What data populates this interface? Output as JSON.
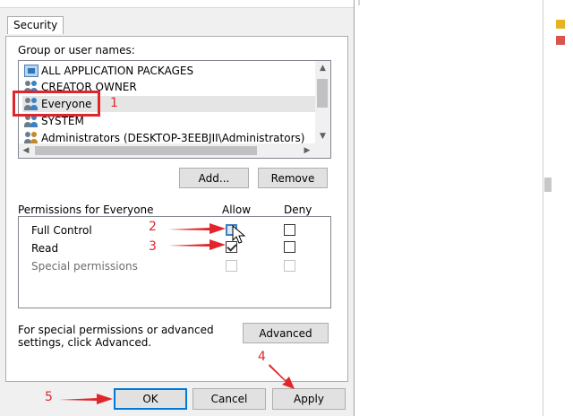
{
  "dialog": {
    "tab_label": "Security",
    "group_label": "Group or user names:",
    "principals": [
      {
        "name": "ALL APPLICATION PACKAGES",
        "icon": "app-packages-icon"
      },
      {
        "name": "CREATOR OWNER",
        "icon": "users-icon"
      },
      {
        "name": "Everyone",
        "icon": "users-icon",
        "selected": true
      },
      {
        "name": "SYSTEM",
        "icon": "users-icon"
      },
      {
        "name": "Administrators (DESKTOP-3EEBJII\\Administrators)",
        "icon": "users-icon"
      }
    ],
    "add_label": "Add...",
    "remove_label": "Remove",
    "permissions_label": "Permissions for Everyone",
    "allow_label": "Allow",
    "deny_label": "Deny",
    "permissions": [
      {
        "name": "Full Control",
        "allow": false,
        "deny": false,
        "enabled": true
      },
      {
        "name": "Read",
        "allow": true,
        "deny": false,
        "enabled": true
      },
      {
        "name": "Special permissions",
        "allow": false,
        "deny": false,
        "enabled": false
      }
    ],
    "advanced_text": "For special permissions or advanced settings, click Advanced.",
    "advanced_label": "Advanced",
    "ok_label": "OK",
    "cancel_label": "Cancel",
    "apply_label": "Apply"
  },
  "annotations": {
    "step1": "1",
    "step2": "2",
    "step3": "3",
    "step4": "4",
    "step5": "5",
    "color": "#e0262b"
  }
}
